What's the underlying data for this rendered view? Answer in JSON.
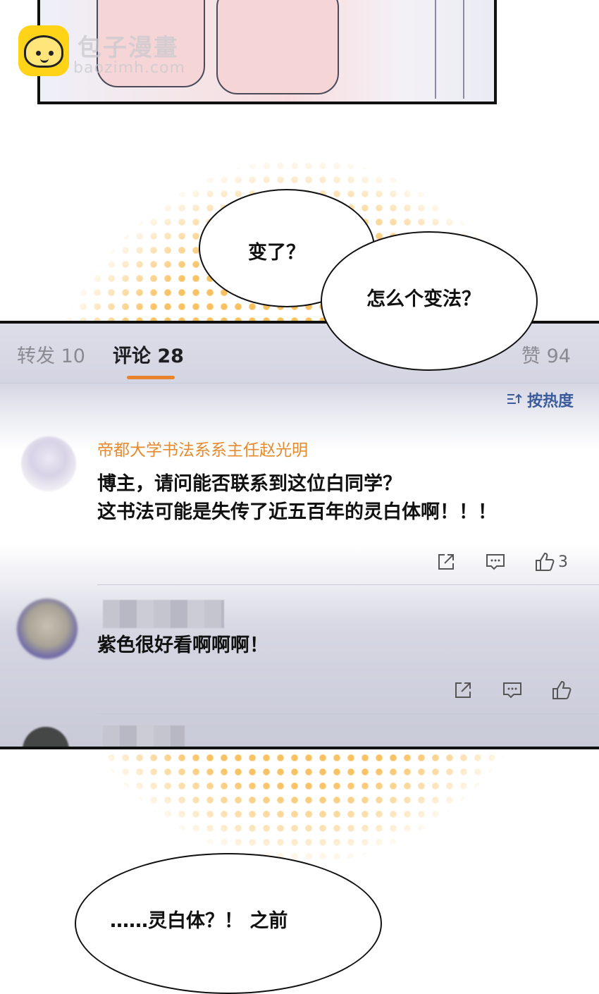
{
  "watermark": {
    "brand_text": "包子漫畫",
    "site_text": "baozimh.com"
  },
  "bubbles": {
    "bubble1_text": "变了？",
    "bubble2_text": "怎么个变法？",
    "bubble3_text": "……灵白体？！ 之前"
  },
  "comments_panel": {
    "tabs": [
      {
        "label": "转发 10"
      },
      {
        "label": "评论 28"
      },
      {
        "label": "赞 94"
      }
    ],
    "sort_label": "按热度",
    "comments": [
      {
        "username": "帝都大学书法系系主任赵光明",
        "text": "博主，请问能否联系到这位白同学？\n这书法可能是失传了近五百年的灵白体啊！！！",
        "likes": "3"
      },
      {
        "username": "",
        "text": "紫色很好看啊啊啊！",
        "likes": ""
      }
    ]
  },
  "icons": [
    "share-icon",
    "comment-icon",
    "like-icon",
    "sort-icon"
  ],
  "colors": {
    "accent_orange": "#e8832c",
    "link_blue": "#3c5b9c",
    "halftone": "#f6b84a"
  }
}
